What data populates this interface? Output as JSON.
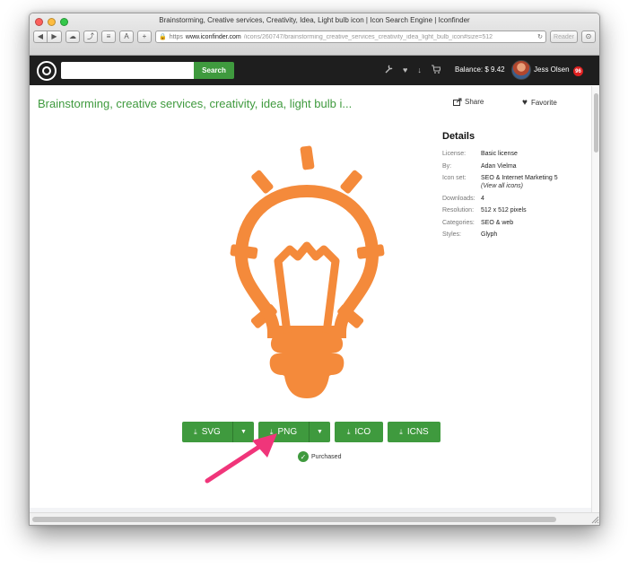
{
  "window": {
    "title": "Brainstorming, Creative services, Creativity, Idea, Light bulb icon | Icon Search Engine | Iconfinder",
    "url_scheme": "https",
    "url_domain": "www.iconfinder.com",
    "url_path": "/icons/260747/brainstorming_creative_services_creativity_idea_light_bulb_icon#size=512",
    "reader_label": "Reader",
    "toolbar_icons": [
      "back-icon",
      "forward-icon",
      "icloud-icon",
      "share-icon",
      "layers-icon",
      "text-icon",
      "new-tab-icon",
      "lock-icon",
      "reload-icon",
      "download-icon"
    ]
  },
  "navbar": {
    "search_value": "",
    "search_label": "Search",
    "icons": [
      "wrench-icon",
      "heart-icon",
      "download-icon",
      "cart-icon"
    ],
    "balance": "Balance: $ 9.42",
    "username": "Jess Olsen",
    "notification_count": "96"
  },
  "page": {
    "title": "Brainstorming, creative services, creativity, idea, light bulb i...",
    "share_label": "Share",
    "favorite_label": "Favorite",
    "icon_color": "#F48A3B",
    "accent_color": "#3F9A3E"
  },
  "details": {
    "heading": "Details",
    "rows": [
      {
        "label": "License:",
        "value": "Basic license",
        "extra": ""
      },
      {
        "label": "By:",
        "value": "Adan Vielma",
        "extra": ""
      },
      {
        "label": "Icon set:",
        "value": "SEO & Internet Marketing 5",
        "extra": "(View all icons)"
      },
      {
        "label": "Downloads:",
        "value": "4",
        "extra": ""
      },
      {
        "label": "Resolution:",
        "value": "512 x 512 pixels",
        "extra": ""
      },
      {
        "label": "Categories:",
        "value": "SEO & web",
        "extra": ""
      },
      {
        "label": "Styles:",
        "value": "Glyph",
        "extra": ""
      }
    ]
  },
  "downloads": {
    "svg": "SVG",
    "png": "PNG",
    "ico": "ICO",
    "icns": "ICNS",
    "purchased": "Purchased"
  }
}
